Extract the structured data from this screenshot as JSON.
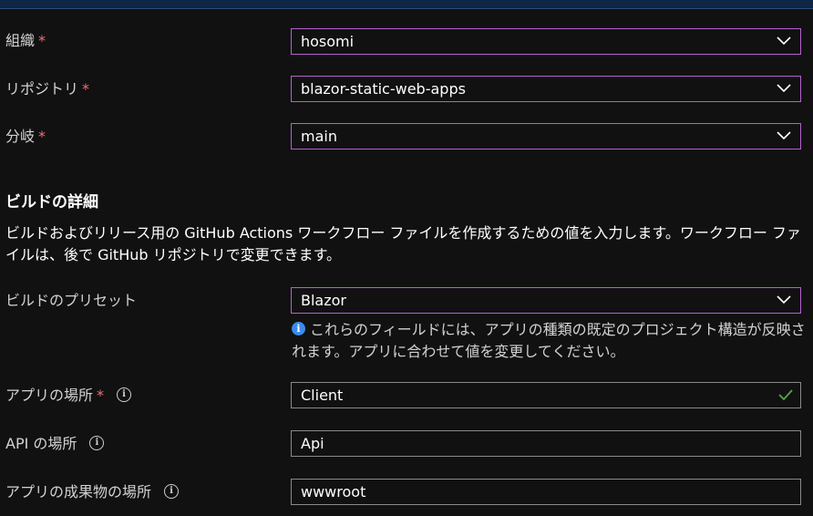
{
  "fields": {
    "org": {
      "label": "組織",
      "value": "hosomi"
    },
    "repo": {
      "label": "リポジトリ",
      "value": "blazor-static-web-apps"
    },
    "branch": {
      "label": "分岐",
      "value": "main"
    },
    "preset": {
      "label": "ビルドのプリセット",
      "value": "Blazor"
    },
    "app_location": {
      "label": "アプリの場所",
      "value": "Client"
    },
    "api_location": {
      "label": "API の場所",
      "value": "Api"
    },
    "output_location": {
      "label": "アプリの成果物の場所",
      "value": "wwwroot"
    }
  },
  "required_marker": "*",
  "build_details": {
    "title": "ビルドの詳細",
    "description": "ビルドおよびリリース用の GitHub Actions ワークフロー ファイルを作成するための値を入力します。ワークフロー ファイルは、後で GitHub リポジトリで変更できます。"
  },
  "preset_note": "これらのフィールドには、アプリの種類の既定のプロジェクト構造が反映されます。アプリに合わせて値を変更してください。",
  "icons": {
    "info": "info-icon",
    "chevron": "chevron-down-icon",
    "check": "checkmark-icon"
  },
  "colors": {
    "dropdown_border": "#b760cf",
    "textbox_border": "#8a8a8a",
    "required": "#f1707b",
    "valid_check": "#57a64a",
    "info_blue": "#3a8bea"
  }
}
